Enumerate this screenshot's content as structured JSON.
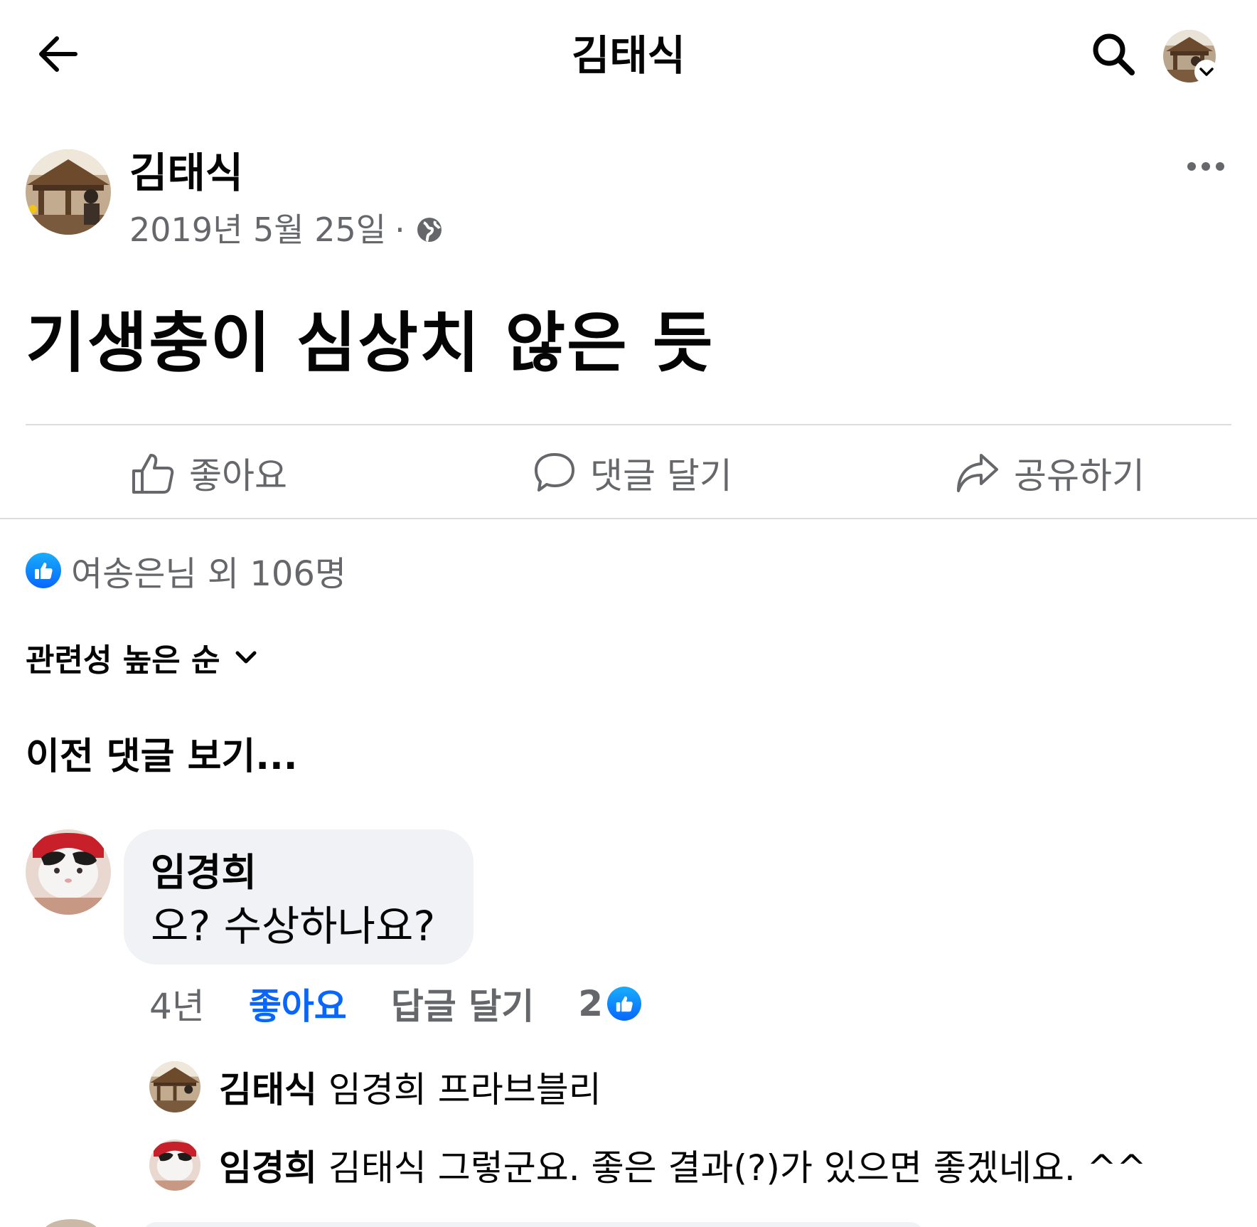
{
  "header": {
    "title": "김태식"
  },
  "post": {
    "author": "김태식",
    "date": "2019년 5월 25일",
    "separator": "·",
    "text": "기생충이 심상치 않은 듯"
  },
  "actions": {
    "like": "좋아요",
    "comment": "댓글 달기",
    "share": "공유하기"
  },
  "reactions": {
    "summary": "여송은님 외 106명"
  },
  "sort": {
    "label": "관련성 높은 순"
  },
  "comments": {
    "previous_label": "이전 댓글 보기...",
    "items": [
      {
        "author": "임경희",
        "text": "오? 수상하나요?",
        "time": "4년",
        "like_label": "좋아요",
        "reply_label": "답글 달기",
        "reaction_count": "2",
        "replies": [
          {
            "author": "김태식",
            "text": "임경희 프라브블리"
          },
          {
            "author": "임경희",
            "text": "김태식 그렇군요. 좋은 결과(?)가 있으면 좋겠네요. ^^"
          }
        ]
      }
    ]
  },
  "colors": {
    "accent": "#0866ff",
    "secondary_text": "#65676b",
    "bubble_bg": "#f0f2f5",
    "divider": "#dadde1"
  },
  "icons": {
    "back": "arrow-left-icon",
    "search": "search-icon",
    "more": "more-horizontal-icon",
    "privacy": "globe-icon",
    "like": "thumbs-up-icon",
    "comment": "comment-bubble-icon",
    "share": "share-arrow-icon",
    "sort": "chevron-down-icon"
  }
}
